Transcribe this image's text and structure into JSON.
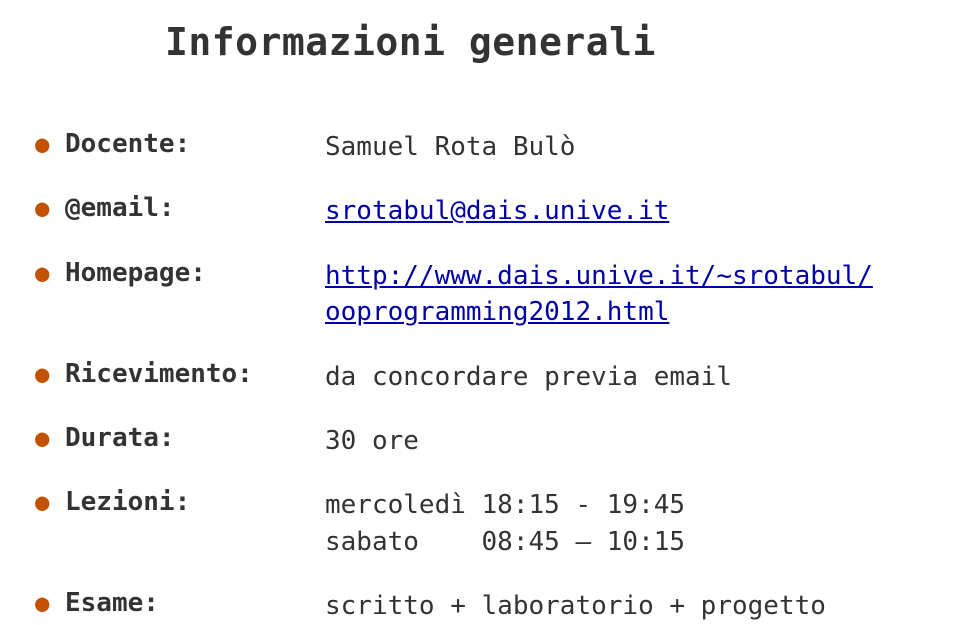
{
  "title": "Informazioni generali",
  "rows": [
    {
      "label": "Docente:",
      "value": "Samuel Rota Bulò",
      "link": false
    },
    {
      "label": "@email:",
      "value": "srotabul@dais.unive.it",
      "link": true
    },
    {
      "label": "Homepage:",
      "value": "http://www.dais.unive.it/~srotabul/\nooprogramming2012.html",
      "link": true
    },
    {
      "label": "Ricevimento:",
      "value": "da concordare previa email",
      "link": false
    },
    {
      "label": "Durata:",
      "value": "30 ore",
      "link": false
    },
    {
      "label": "Lezioni:",
      "value": "mercoledì 18:15 - 19:45\nsabato    08:45 – 10:15",
      "link": false
    },
    {
      "label": "Esame:",
      "value": "scritto + laboratorio + progetto",
      "link": false
    }
  ]
}
